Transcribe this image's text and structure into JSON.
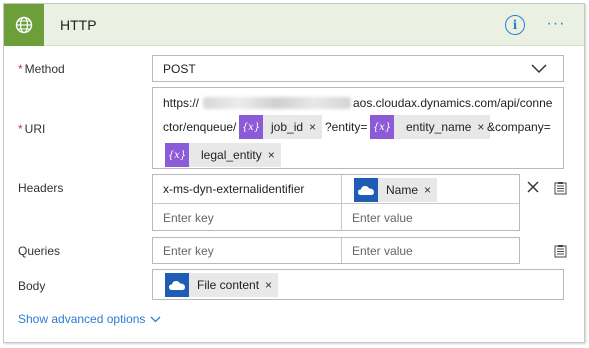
{
  "header": {
    "title": "HTTP",
    "accent_color": "#6c9f3a",
    "icon": "globe-icon",
    "info_label": "i",
    "more_label": "···"
  },
  "method": {
    "label": "Method",
    "required_mark": "*",
    "value": "POST",
    "icon": "chevron-down-icon"
  },
  "uri": {
    "label": "URI",
    "required_mark": "*",
    "prefix": "https://",
    "host_suffix": "aos.cloudax.dynamics.com/api/conne",
    "line2_text": "ctor/enqueue/",
    "separator_entity": "?entity=",
    "separator_company": "&company=",
    "tokens": [
      {
        "label": "job_id",
        "kind": "expression"
      },
      {
        "label": "entity_name",
        "kind": "expression"
      },
      {
        "label": "legal_entity",
        "kind": "expression"
      }
    ],
    "token_icon_text": "{x}",
    "remove_label": "×"
  },
  "headers": {
    "label": "Headers",
    "rows": [
      {
        "key": "x-ms-dyn-externalidentifier",
        "value_token": "Name"
      },
      {
        "key_placeholder": "Enter key",
        "value_placeholder": "Enter value"
      }
    ],
    "remove_label": "×"
  },
  "queries": {
    "label": "Queries",
    "key_placeholder": "Enter key",
    "value_placeholder": "Enter value"
  },
  "body": {
    "label": "Body",
    "token": "File content",
    "remove_label": "×"
  },
  "footer": {
    "advanced_label": "Show advanced options"
  }
}
